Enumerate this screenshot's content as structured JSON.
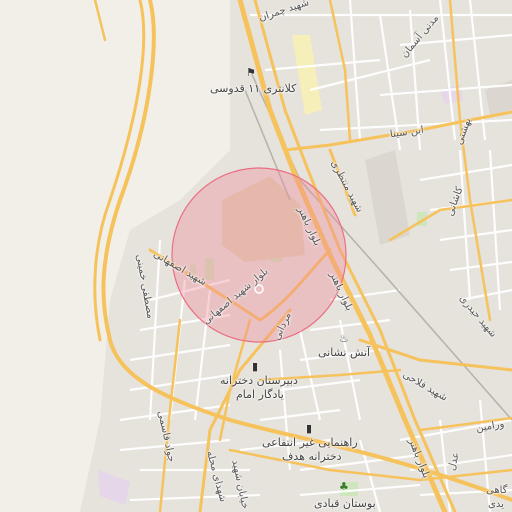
{
  "map": {
    "accuracy_circle_color": "#f28b9a",
    "poi_labels": {
      "police_station": "کلانتری ۱۱ قدوسی",
      "fire_station": "آتش نشانی",
      "girls_highschool": "دبیرستان دخترانه",
      "girls_highschool_line2": "یادگار امام",
      "driving_school": "راهنمایی غیر انتفاعی",
      "driving_school_line2": "دخترانه هدف",
      "park": "بوستان قبادی"
    },
    "road_labels": {
      "chamran": "شهید چمران",
      "asman": "مدنی آسمان",
      "ibn_sina": "ابن سینا",
      "beheshti": "بهشتی",
      "kashani": "کاشانی",
      "montazeri": "شهید منتظری",
      "haydari": "شهید حیدری",
      "baher_1": "بلوار باهنر",
      "baher_2": "بلوار باهنر",
      "baher_3": "بلوار باهنر",
      "isfahani_1": "بلوار شهید اصفهانی",
      "isfahani_2": "شهید اصفهانی",
      "khamenei": "مصطفی خمینی",
      "mardani": "مردانی",
      "ghasemi": "جواد قاسمی",
      "falahi": "شهید فلاحی",
      "varamin": "ورامین",
      "adl": "عدل",
      "shahidi": "شهدای محله",
      "khiaban": "خیابان شهید",
      "gahi": "گاهی",
      "didi": "یدی"
    },
    "icons": [
      "police-icon",
      "fire-station-icon",
      "school-icon",
      "school-icon",
      "park-icon"
    ]
  }
}
